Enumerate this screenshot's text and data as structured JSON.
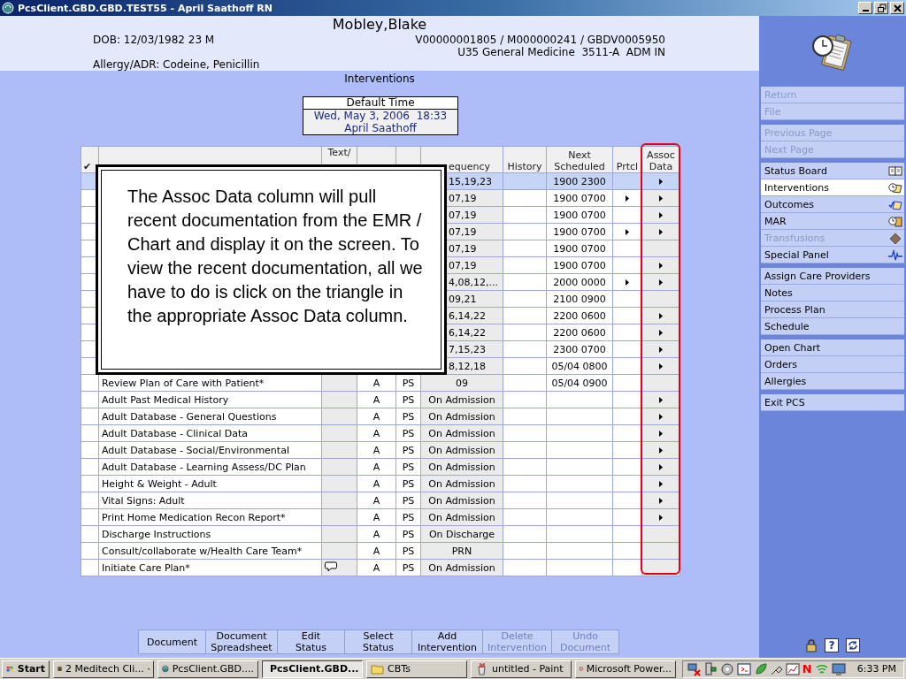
{
  "window": {
    "title": "PcsClient.GBD.GBD.TEST55 - April Saathoff RN"
  },
  "patient": {
    "name": "Mobley,Blake",
    "dob": "DOB: 12/03/1982 23 M",
    "account": "V00000001805 / M000000241 / GBDV0005950",
    "location": "U35 General Medicine  3511-A  ADM IN",
    "allergy": "Allergy/ADR: Codeine, Penicillin"
  },
  "page_title": "Interventions",
  "default_time": {
    "label": "Default Time",
    "datetime": "Wed, May 3, 2006  18:33",
    "user": "April Saathoff"
  },
  "table": {
    "columns": [
      "✔",
      null,
      "Text/",
      null,
      null,
      "equency",
      "History",
      "Next Scheduled",
      "Prtcl",
      "Assoc Data"
    ],
    "rows": [
      {
        "selected": true,
        "frequency": "15,19,23",
        "next_scheduled": "1900 2300",
        "prtcl": false,
        "assoc_data": true
      },
      {
        "selected": false,
        "frequency": "07,19",
        "next_scheduled": "1900 0700",
        "prtcl": true,
        "assoc_data": true
      },
      {
        "selected": false,
        "frequency": "07,19",
        "next_scheduled": "1900 0700",
        "prtcl": false,
        "assoc_data": true
      },
      {
        "selected": false,
        "frequency": "07,19",
        "next_scheduled": "1900 0700",
        "prtcl": true,
        "assoc_data": true
      },
      {
        "selected": false,
        "frequency": "07,19",
        "next_scheduled": "1900 0700",
        "prtcl": false,
        "assoc_data": false
      },
      {
        "selected": false,
        "frequency": "07,19",
        "next_scheduled": "1900 0700",
        "prtcl": false,
        "assoc_data": true
      },
      {
        "selected": false,
        "frequency": "4,08,12,...",
        "next_scheduled": "2000 0000",
        "prtcl": true,
        "assoc_data": true
      },
      {
        "selected": false,
        "frequency": "09,21",
        "next_scheduled": "2100 0900",
        "prtcl": false,
        "assoc_data": false
      },
      {
        "selected": false,
        "frequency": "6,14,22",
        "next_scheduled": "2200 0600",
        "prtcl": false,
        "assoc_data": true
      },
      {
        "selected": false,
        "frequency": "6,14,22",
        "next_scheduled": "2200 0600",
        "prtcl": false,
        "assoc_data": true
      },
      {
        "selected": false,
        "frequency": "7,15,23",
        "next_scheduled": "2300 0700",
        "prtcl": false,
        "assoc_data": true
      },
      {
        "selected": false,
        "frequency": "8,12,18",
        "next_scheduled": "05/04 0800",
        "prtcl": false,
        "assoc_data": true
      },
      {
        "selected": false,
        "intervention": "Review Plan of Care with Patient*",
        "note": false,
        "status": "A",
        "s": "PS",
        "frequency": "09",
        "next_scheduled": "05/04 0900",
        "prtcl": false,
        "assoc_data": false
      },
      {
        "selected": false,
        "intervention": "Adult Past Medical History",
        "note": false,
        "status": "A",
        "s": "PS",
        "frequency": "On Admission",
        "prtcl": false,
        "assoc_data": true
      },
      {
        "selected": false,
        "intervention": "Adult Database - General Questions",
        "note": false,
        "status": "A",
        "s": "PS",
        "frequency": "On Admission",
        "prtcl": false,
        "assoc_data": true
      },
      {
        "selected": false,
        "intervention": "Adult Database - Clinical Data",
        "note": false,
        "status": "A",
        "s": "PS",
        "frequency": "On Admission",
        "prtcl": false,
        "assoc_data": true
      },
      {
        "selected": false,
        "intervention": "Adult Database - Social/Environmental",
        "note": false,
        "status": "A",
        "s": "PS",
        "frequency": "On Admission",
        "prtcl": false,
        "assoc_data": true
      },
      {
        "selected": false,
        "intervention": "Adult Database - Learning Assess/DC Plan",
        "note": false,
        "status": "A",
        "s": "PS",
        "frequency": "On Admission",
        "prtcl": false,
        "assoc_data": true
      },
      {
        "selected": false,
        "intervention": "Height & Weight - Adult",
        "note": false,
        "status": "A",
        "s": "PS",
        "frequency": "On Admission",
        "prtcl": false,
        "assoc_data": true
      },
      {
        "selected": false,
        "intervention": "Vital Signs: Adult",
        "note": false,
        "status": "A",
        "s": "PS",
        "frequency": "On Admission",
        "prtcl": false,
        "assoc_data": true
      },
      {
        "selected": false,
        "intervention": "Print Home Medication Recon Report*",
        "note": false,
        "status": "A",
        "s": "PS",
        "frequency": "On Admission",
        "prtcl": false,
        "assoc_data": true
      },
      {
        "selected": false,
        "intervention": "Discharge Instructions",
        "note": false,
        "status": "A",
        "s": "PS",
        "frequency": "On Discharge",
        "prtcl": false,
        "assoc_data": false
      },
      {
        "selected": false,
        "intervention": "Consult/collaborate w/Health Care Team*",
        "note": false,
        "status": "A",
        "s": "PS",
        "frequency": "PRN",
        "prtcl": false,
        "assoc_data": false
      },
      {
        "selected": false,
        "intervention": "Initiate Care Plan*",
        "note": true,
        "status": "A",
        "s": "PS",
        "frequency": "On Admission",
        "prtcl": false,
        "assoc_data": false
      }
    ]
  },
  "callout": {
    "text": "The Assoc Data column will pull recent documentation from the EMR / Chart and display it on the screen. To view the recent documentation, all we have to do is click on the triangle in the appropriate Assoc Data column."
  },
  "actions": [
    {
      "label": "Document",
      "disabled": false
    },
    {
      "label": "Document\nSpreadsheet",
      "disabled": false
    },
    {
      "label": "Edit\nStatus",
      "disabled": false
    },
    {
      "label": "Select\nStatus",
      "disabled": false
    },
    {
      "label": "Add\nIntervention",
      "disabled": false
    },
    {
      "label": "Delete\nIntervention",
      "disabled": true
    },
    {
      "label": "Undo\nDocument",
      "disabled": true
    }
  ],
  "sidebar": {
    "groups": [
      [
        {
          "label": "Return",
          "disabled": true,
          "selected": false
        },
        {
          "label": "File",
          "disabled": true,
          "selected": false
        }
      ],
      [
        {
          "label": "Previous Page",
          "disabled": true,
          "selected": false
        },
        {
          "label": "Next Page",
          "disabled": true,
          "selected": false
        }
      ],
      [
        {
          "label": "Status Board",
          "disabled": false,
          "selected": false,
          "kind": "book"
        },
        {
          "label": "Interventions",
          "disabled": false,
          "selected": true,
          "kind": "clockpad"
        },
        {
          "label": "Outcomes",
          "disabled": false,
          "selected": false,
          "kind": "checkpad"
        },
        {
          "label": "MAR",
          "disabled": false,
          "selected": false,
          "kind": "clockbox"
        },
        {
          "label": "Transfusions",
          "disabled": true,
          "selected": false,
          "kind": "bag"
        },
        {
          "label": "Special Panel",
          "disabled": false,
          "selected": false,
          "kind": "pulse"
        }
      ],
      [
        {
          "label": "Assign Care Providers",
          "disabled": false,
          "selected": false
        },
        {
          "label": "Notes",
          "disabled": false,
          "selected": false
        },
        {
          "label": "Process Plan",
          "disabled": false,
          "selected": false
        },
        {
          "label": "Schedule",
          "disabled": false,
          "selected": false
        }
      ],
      [
        {
          "label": "Open Chart",
          "disabled": false,
          "selected": false
        },
        {
          "label": "Orders",
          "disabled": false,
          "selected": false
        },
        {
          "label": "Allergies",
          "disabled": false,
          "selected": false
        }
      ],
      [
        {
          "label": "Exit PCS",
          "disabled": false,
          "selected": false
        }
      ]
    ],
    "help_label": "?"
  },
  "taskbar": {
    "start": "Start",
    "tasks": [
      {
        "label": "2 Meditech Cli...",
        "kind": "group",
        "selected": false
      },
      {
        "label": "PcsClient.GBD....",
        "kind": "pcs",
        "selected": false
      },
      {
        "label": "PcsClient.GBD...",
        "kind": "pcs",
        "selected": true
      },
      {
        "label": "CBTs",
        "kind": "folder",
        "selected": false
      },
      {
        "label": "untitled - Paint",
        "kind": "paint",
        "selected": false
      },
      {
        "label": "Microsoft Power...",
        "kind": "powerpoint",
        "selected": false
      }
    ],
    "tray_letter": "N",
    "clock": "6:33 PM"
  }
}
